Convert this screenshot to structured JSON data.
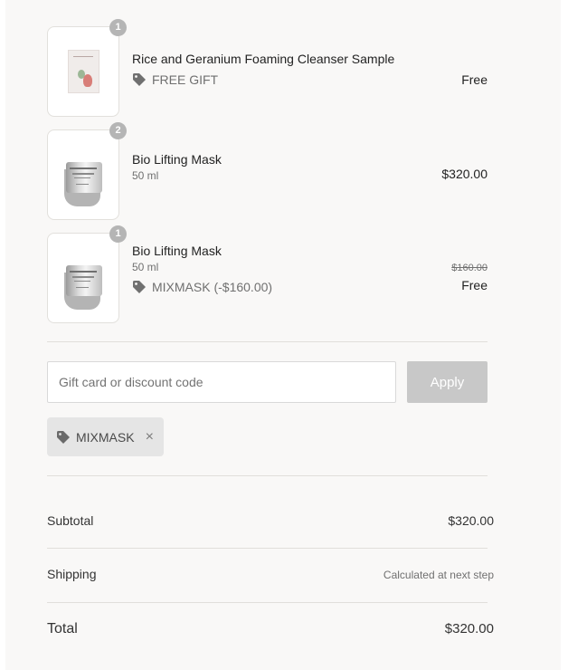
{
  "items": [
    {
      "quantity": "1",
      "name": "Rice and Geranium Foaming Cleanser Sample",
      "discount_label": "FREE GIFT",
      "price": "Free",
      "image": "cleanser-sample-image"
    },
    {
      "quantity": "2",
      "name": "Bio Lifting Mask",
      "variant": "50 ml",
      "price": "$320.00",
      "image": "jar-image"
    },
    {
      "quantity": "1",
      "name": "Bio Lifting Mask",
      "variant": "50 ml",
      "discount_label": "MIXMASK (-$160.00)",
      "original_price": "$160.00",
      "price": "Free",
      "image": "jar-image"
    }
  ],
  "discount": {
    "placeholder": "Gift card or discount code",
    "apply_label": "Apply",
    "applied_code": "MIXMASK",
    "remove_icon": "×"
  },
  "summary": {
    "subtotal_label": "Subtotal",
    "subtotal_value": "$320.00",
    "shipping_label": "Shipping",
    "shipping_value": "Calculated at next step",
    "total_label": "Total",
    "total_value": "$320.00"
  },
  "colors": {
    "panel_bg": "#f9f8f7",
    "apply_disabled": "#c8c8c8",
    "chip_bg": "#e5e5e5"
  }
}
